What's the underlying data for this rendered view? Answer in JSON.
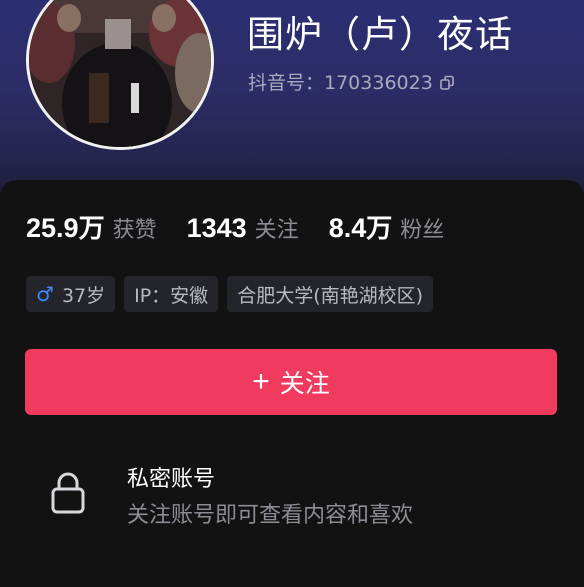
{
  "profile": {
    "nickname": "围炉（卢）夜话",
    "account_id_label": "抖音号：170336023"
  },
  "stats": [
    {
      "value": "25.9",
      "unit": "万",
      "label": "获赞"
    },
    {
      "value": "1343",
      "unit": "",
      "label": "关注"
    },
    {
      "value": "8.4",
      "unit": "万",
      "label": "粉丝"
    }
  ],
  "tags": {
    "gender_icon": "♂",
    "age": "37岁",
    "ip": "IP：安徽",
    "school": "合肥大学(南艳湖校区)"
  },
  "follow_button": {
    "plus": "+",
    "label": "关注"
  },
  "private_account": {
    "title": "私密账号",
    "description": "关注账号即可查看内容和喜欢"
  },
  "icons": {
    "gender": "male-icon",
    "copy": "copy-icon",
    "lock": "lock-icon"
  },
  "colors": {
    "accent": "#f03a5e",
    "header_bg": "#2c2c66",
    "card_bg": "#121212",
    "gender_blue": "#3d8bff"
  }
}
